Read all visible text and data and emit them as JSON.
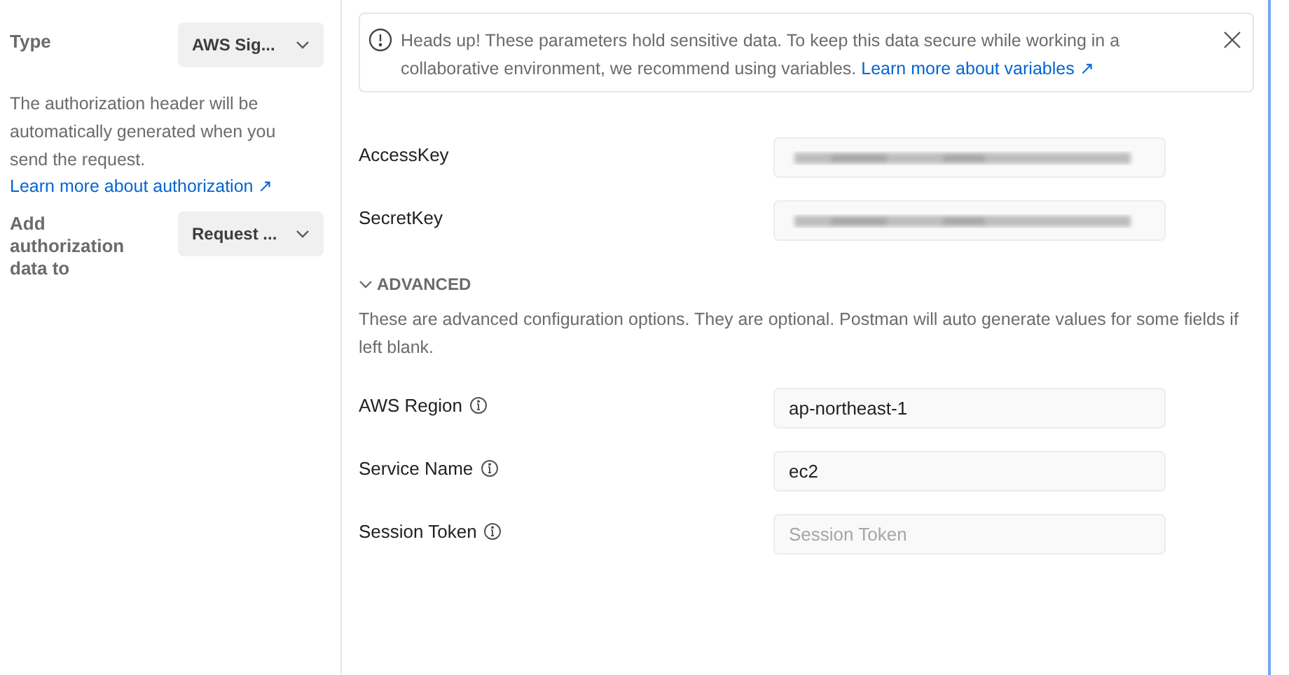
{
  "sidebar": {
    "type_label": "Type",
    "type_select": "AWS Sig...",
    "description": "The authorization header will be automatically generated when you send the request.",
    "learn_link": "Learn more about authorization ↗",
    "add_label": "Add authorization data to",
    "add_select": "Request ..."
  },
  "alert": {
    "text": "Heads up! These parameters hold sensitive data. To keep this data secure while working in a collaborative environment, we recommend using variables.",
    "link": "Learn more about variables ↗"
  },
  "fields": [
    {
      "label": "AccessKey",
      "kind": "redacted",
      "info": false
    },
    {
      "label": "SecretKey",
      "kind": "redacted",
      "info": false
    }
  ],
  "advanced": {
    "title": "ADVANCED",
    "expanded": true,
    "description": "These are advanced configuration options. They are optional. Postman will auto generate values for some fields if left blank.",
    "fields": [
      {
        "label": "AWS Region",
        "kind": "value",
        "value": "ap-northeast-1",
        "info": true
      },
      {
        "label": "Service Name",
        "kind": "value",
        "value": "ec2",
        "info": true
      },
      {
        "label": "Session Token",
        "kind": "placeholder",
        "placeholder": "Session Token",
        "info": true
      }
    ]
  }
}
